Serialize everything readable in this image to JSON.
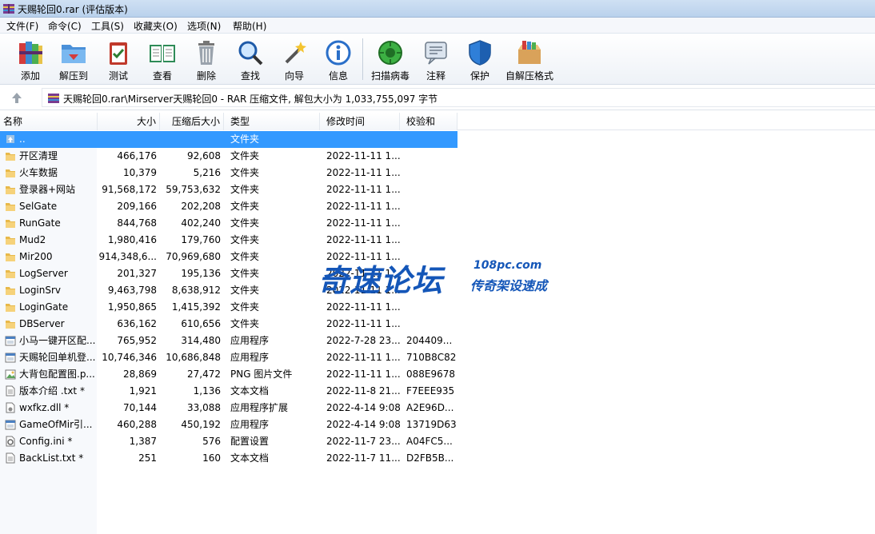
{
  "window": {
    "title": "天赐轮回0.rar (评估版本)"
  },
  "menu": [
    "文件(F)",
    "命令(C)",
    "工具(S)",
    "收藏夹(O)",
    "选项(N)",
    "帮助(H)"
  ],
  "toolbar": [
    {
      "label": "添加",
      "icon": "add-books-icon"
    },
    {
      "label": "解压到",
      "icon": "extract-folder-icon"
    },
    {
      "label": "测试",
      "icon": "test-clipboard-icon"
    },
    {
      "label": "查看",
      "icon": "view-book-icon"
    },
    {
      "label": "删除",
      "icon": "trash-icon"
    },
    {
      "label": "查找",
      "icon": "magnifier-icon"
    },
    {
      "label": "向导",
      "icon": "wizard-wand-icon"
    },
    {
      "label": "信息",
      "icon": "info-icon"
    },
    {
      "label": "扫描病毒",
      "icon": "virus-scan-icon"
    },
    {
      "label": "注释",
      "icon": "comment-icon"
    },
    {
      "label": "保护",
      "icon": "shield-icon"
    },
    {
      "label": "自解压格式",
      "icon": "sfx-box-icon"
    }
  ],
  "address": {
    "path": "天赐轮回0.rar\\Mirserver天赐轮回0 - RAR 压缩文件, 解包大小为 1,033,755,097 字节"
  },
  "columns": {
    "name": "名称",
    "size": "大小",
    "packed": "压缩后大小",
    "type": "类型",
    "modified": "修改时间",
    "crc": "校验和"
  },
  "files": [
    {
      "name": "..",
      "size": "",
      "packed": "",
      "type": "文件夹",
      "modified": "",
      "crc": "",
      "kind": "up",
      "selected": true
    },
    {
      "name": "开区清理",
      "size": "466,176",
      "packed": "92,608",
      "type": "文件夹",
      "modified": "2022-11-11 1...",
      "crc": "",
      "kind": "folder"
    },
    {
      "name": "火车数据",
      "size": "10,379",
      "packed": "5,216",
      "type": "文件夹",
      "modified": "2022-11-11 1...",
      "crc": "",
      "kind": "folder"
    },
    {
      "name": "登录器+网站",
      "size": "91,568,172",
      "packed": "59,753,632",
      "type": "文件夹",
      "modified": "2022-11-11 1...",
      "crc": "",
      "kind": "folder"
    },
    {
      "name": "SelGate",
      "size": "209,166",
      "packed": "202,208",
      "type": "文件夹",
      "modified": "2022-11-11 1...",
      "crc": "",
      "kind": "folder"
    },
    {
      "name": "RunGate",
      "size": "844,768",
      "packed": "402,240",
      "type": "文件夹",
      "modified": "2022-11-11 1...",
      "crc": "",
      "kind": "folder"
    },
    {
      "name": "Mud2",
      "size": "1,980,416",
      "packed": "179,760",
      "type": "文件夹",
      "modified": "2022-11-11 1...",
      "crc": "",
      "kind": "folder"
    },
    {
      "name": "Mir200",
      "size": "914,348,6...",
      "packed": "70,969,680",
      "type": "文件夹",
      "modified": "2022-11-11 1...",
      "crc": "",
      "kind": "folder"
    },
    {
      "name": "LogServer",
      "size": "201,327",
      "packed": "195,136",
      "type": "文件夹",
      "modified": "2022-11-11 1...",
      "crc": "",
      "kind": "folder"
    },
    {
      "name": "LoginSrv",
      "size": "9,463,798",
      "packed": "8,638,912",
      "type": "文件夹",
      "modified": "2022-11-11 1...",
      "crc": "",
      "kind": "folder"
    },
    {
      "name": "LoginGate",
      "size": "1,950,865",
      "packed": "1,415,392",
      "type": "文件夹",
      "modified": "2022-11-11 1...",
      "crc": "",
      "kind": "folder"
    },
    {
      "name": "DBServer",
      "size": "636,162",
      "packed": "610,656",
      "type": "文件夹",
      "modified": "2022-11-11 1...",
      "crc": "",
      "kind": "folder"
    },
    {
      "name": "小马一键开区配...",
      "size": "765,952",
      "packed": "314,480",
      "type": "应用程序",
      "modified": "2022-7-28 23...",
      "crc": "204409...",
      "kind": "exe"
    },
    {
      "name": "天赐轮回单机登...",
      "size": "10,746,346",
      "packed": "10,686,848",
      "type": "应用程序",
      "modified": "2022-11-11 1...",
      "crc": "710B8C82",
      "kind": "exe"
    },
    {
      "name": "大背包配置图.p...",
      "size": "28,869",
      "packed": "27,472",
      "type": "PNG 图片文件",
      "modified": "2022-11-11 1...",
      "crc": "088E9678",
      "kind": "png"
    },
    {
      "name": "版本介绍 .txt *",
      "size": "1,921",
      "packed": "1,136",
      "type": "文本文档",
      "modified": "2022-11-8 21...",
      "crc": "F7EEE935",
      "kind": "txt"
    },
    {
      "name": "wxfkz.dll *",
      "size": "70,144",
      "packed": "33,088",
      "type": "应用程序扩展",
      "modified": "2022-4-14 9:08",
      "crc": "A2E96D...",
      "kind": "dll"
    },
    {
      "name": "GameOfMir引...",
      "size": "460,288",
      "packed": "450,192",
      "type": "应用程序",
      "modified": "2022-4-14 9:08",
      "crc": "13719D63",
      "kind": "exe"
    },
    {
      "name": "Config.ini *",
      "size": "1,387",
      "packed": "576",
      "type": "配置设置",
      "modified": "2022-11-7 23...",
      "crc": "A04FC5...",
      "kind": "ini"
    },
    {
      "name": "BackList.txt *",
      "size": "251",
      "packed": "160",
      "type": "文本文档",
      "modified": "2022-11-7 11...",
      "crc": "D2FB5B...",
      "kind": "txt"
    }
  ],
  "watermark": {
    "brand": "奇速论坛",
    "url": "108pc.com",
    "tagline": "传奇架设速成"
  }
}
